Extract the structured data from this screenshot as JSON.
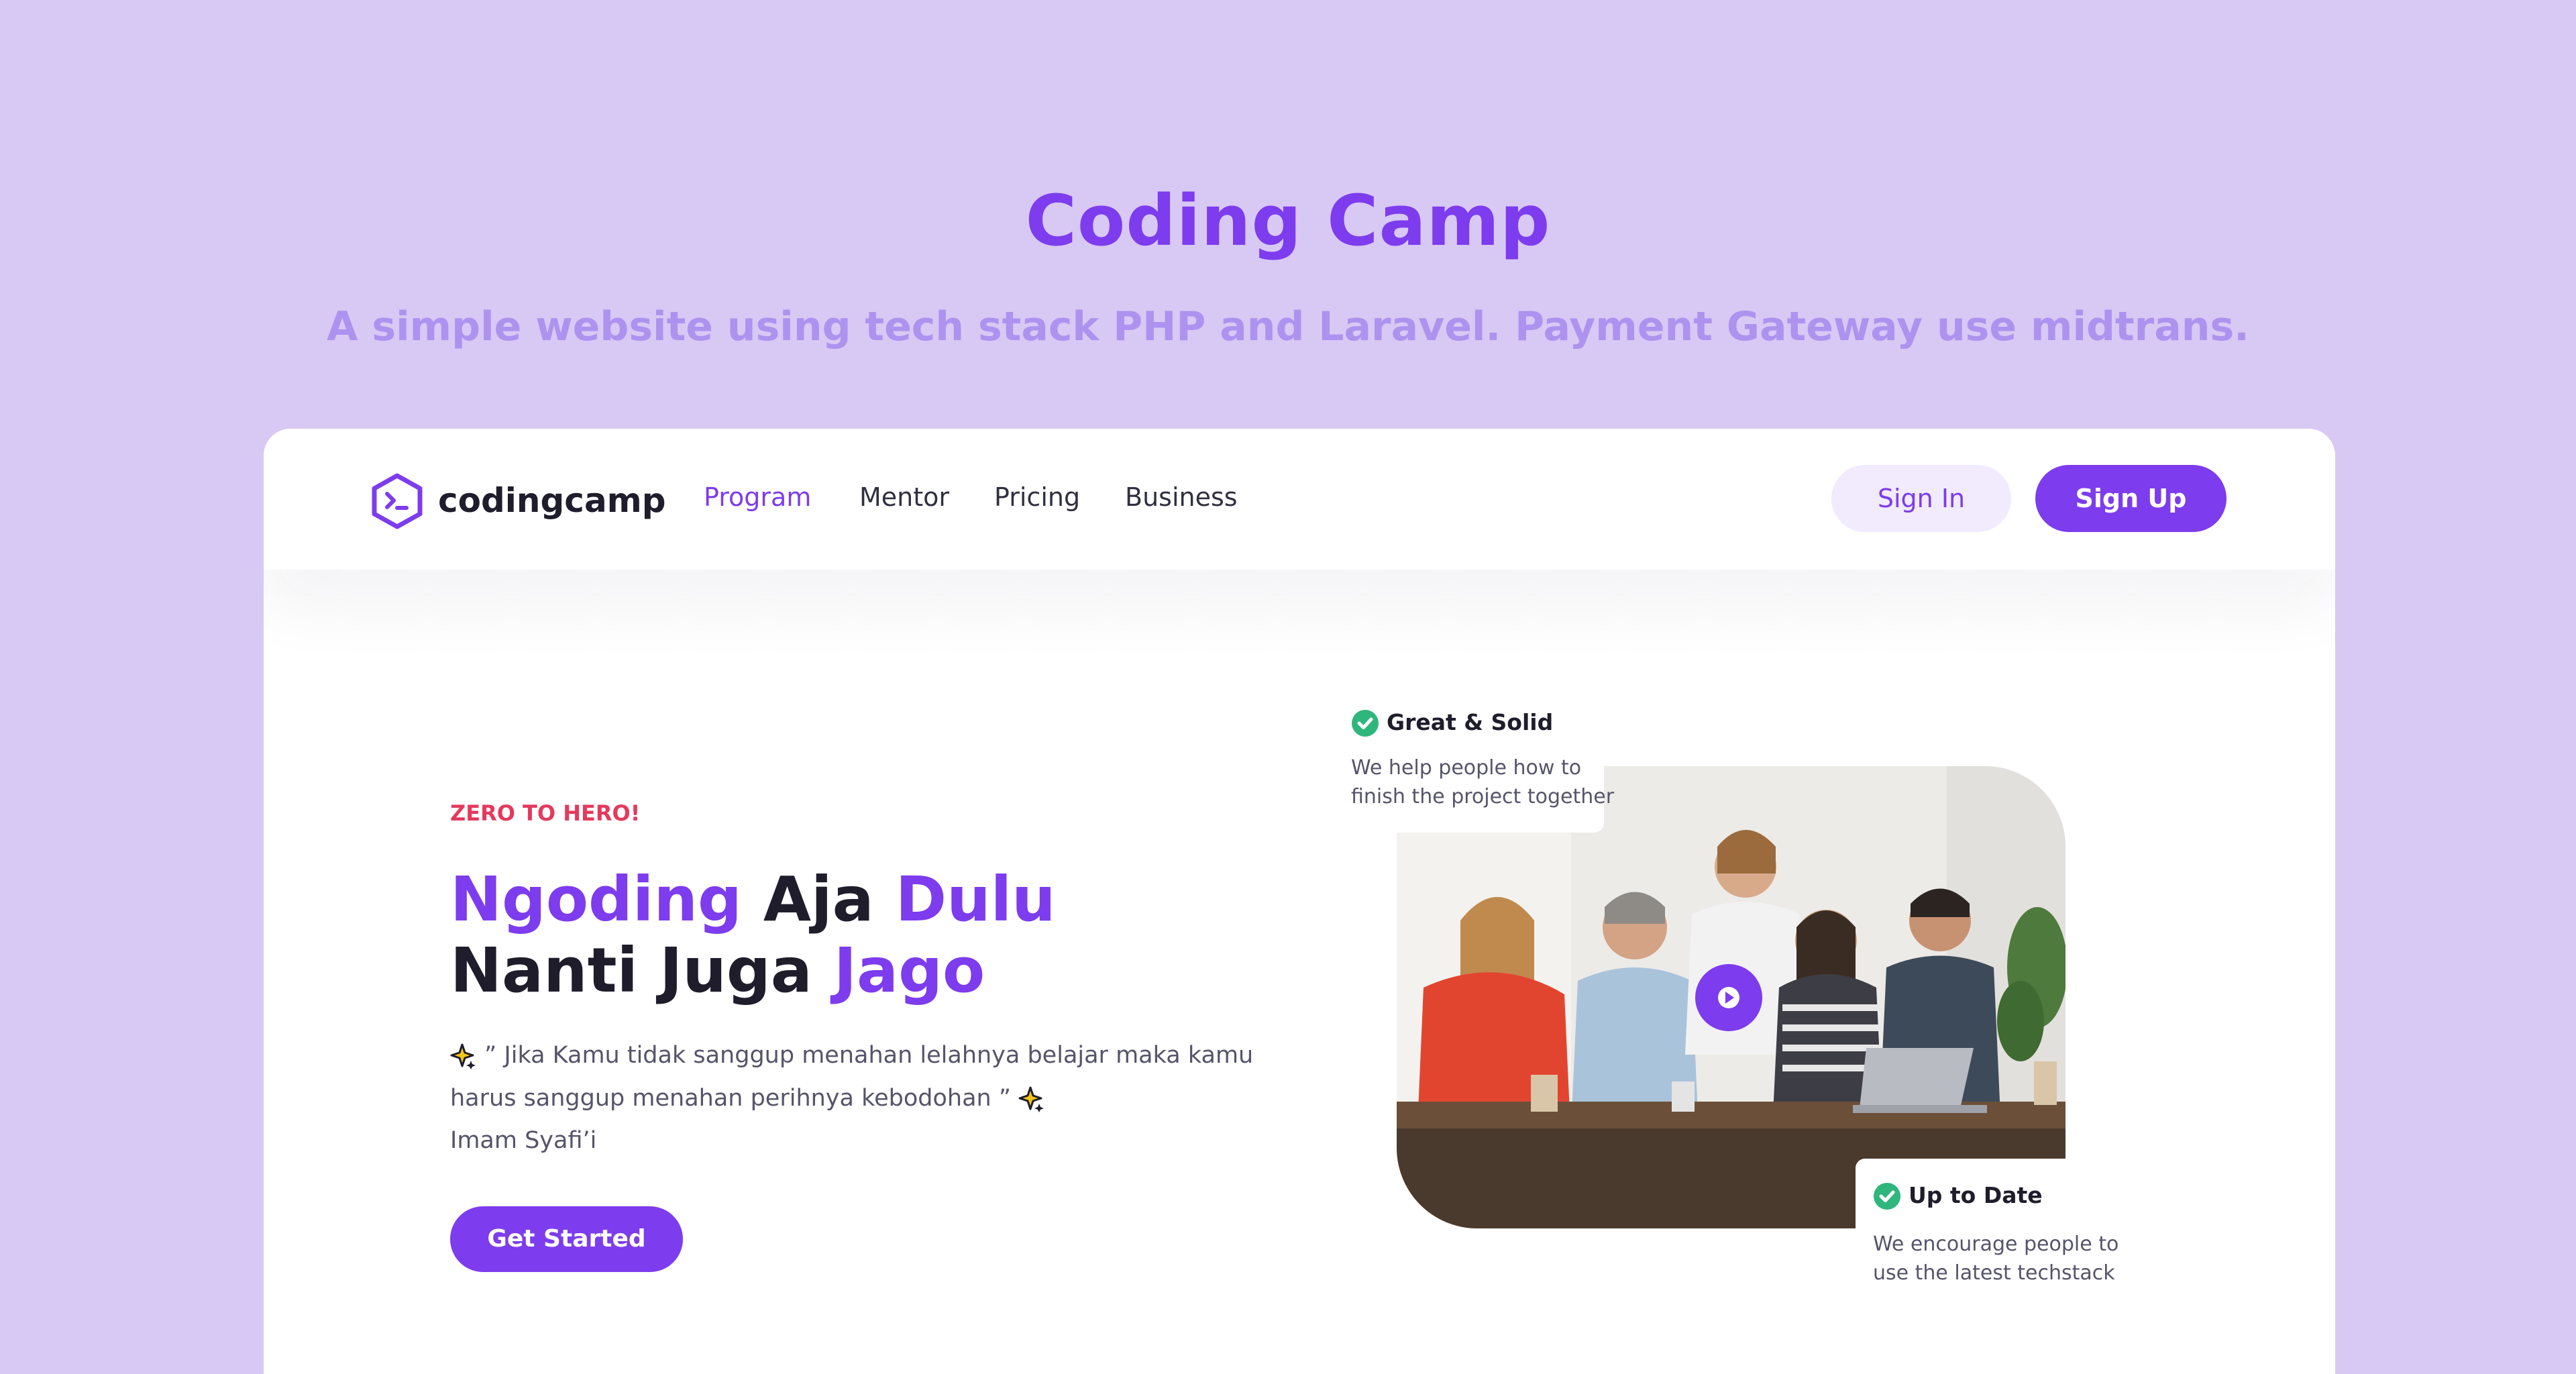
{
  "page": {
    "title": "Coding Camp",
    "subtitle": "A simple website using tech stack PHP and Laravel. Payment Gateway use midtrans."
  },
  "navbar": {
    "logo_text": "codingcamp",
    "links": [
      {
        "label": "Program",
        "active": true
      },
      {
        "label": "Mentor",
        "active": false
      },
      {
        "label": "Pricing",
        "active": false
      },
      {
        "label": "Business",
        "active": false
      }
    ],
    "sign_in_label": "Sign In",
    "sign_up_label": "Sign Up"
  },
  "hero": {
    "eyebrow": "ZERO TO HERO!",
    "headline_line1": {
      "part1": "Ngoding",
      "part2": "Aja",
      "part3": "Dulu"
    },
    "headline_line2": {
      "part1": "Nanti Juga",
      "part2": "Jago"
    },
    "quote_line1": "” Jika Kamu tidak sanggup menahan lelahnya belajar maka kamu",
    "quote_line2": "harus sanggup menahan perihnya kebodohan ”",
    "quote_author": "Imam Syafi’i",
    "cta_label": "Get Started"
  },
  "cards": {
    "card1": {
      "title": "Great & Solid",
      "text_line1": "We help people how to",
      "text_line2": "finish the project together"
    },
    "card2": {
      "title": "Up to Date",
      "text_line1": "We encourage people to",
      "text_line2": "use the latest techstack"
    }
  },
  "colors": {
    "background": "#d8c8f4",
    "accent": "#7d3ced",
    "eyebrow": "#e5395d",
    "check": "#2fb67c"
  },
  "icons": {
    "logo": "terminal-hexagon-icon",
    "play": "play-icon",
    "check": "check-circle-icon",
    "sparkle": "sparkle-icon"
  }
}
